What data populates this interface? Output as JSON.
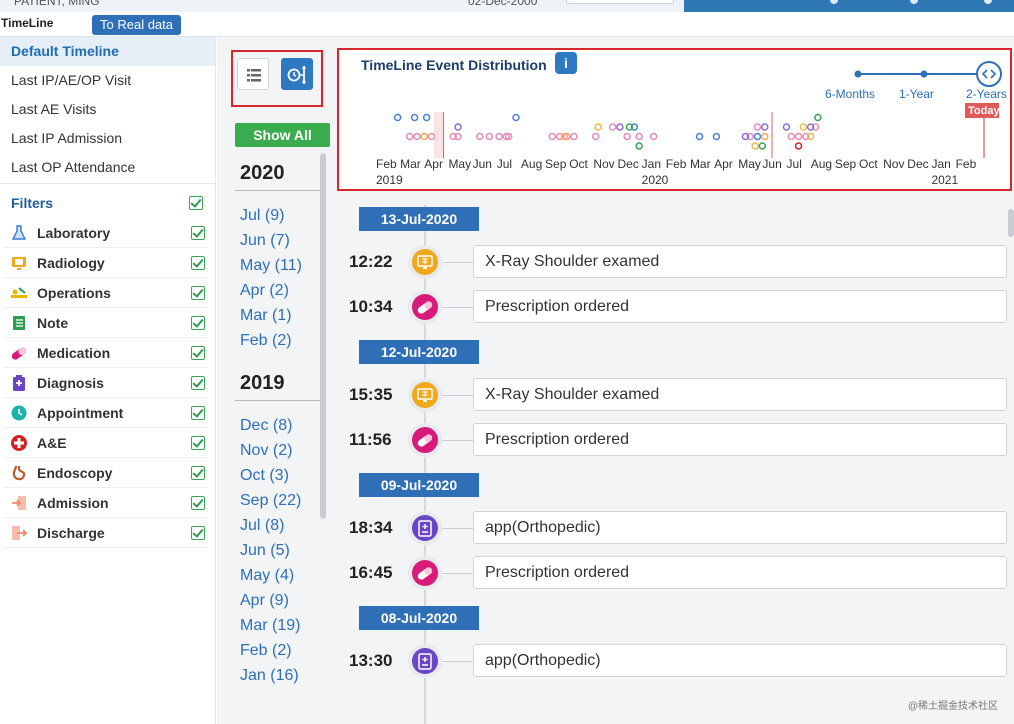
{
  "header": {
    "patient": "PATIENT, MING",
    "date": "02-Dec-2000",
    "app_title": "TimeLine",
    "real_data_button": "To Real data"
  },
  "sidebar": {
    "menu": [
      {
        "label": "Default Timeline",
        "active": true
      },
      {
        "label": "Last IP/AE/OP Visit",
        "active": false
      },
      {
        "label": "Last AE Visits",
        "active": false
      },
      {
        "label": "Last IP Admission",
        "active": false
      },
      {
        "label": "Last OP Attendance",
        "active": false
      }
    ],
    "filters_label": "Filters",
    "filters": [
      {
        "label": "Laboratory",
        "icon": "flask-icon",
        "color": "#3a7bd5",
        "checked": true
      },
      {
        "label": "Radiology",
        "icon": "xray-monitor-icon",
        "color": "#f0a81c",
        "checked": true
      },
      {
        "label": "Operations",
        "icon": "surgery-bed-icon",
        "color": "#e6b800",
        "checked": true
      },
      {
        "label": "Note",
        "icon": "notebook-icon",
        "color": "#2e9b4e",
        "checked": true
      },
      {
        "label": "Medication",
        "icon": "pill-capsule-icon",
        "color": "#d81b7a",
        "checked": true
      },
      {
        "label": "Diagnosis",
        "icon": "clipboard-plus-icon",
        "color": "#6a45c6",
        "checked": true
      },
      {
        "label": "Appointment",
        "icon": "clock-icon",
        "color": "#19b3a8",
        "checked": true
      },
      {
        "label": "A&E",
        "icon": "red-cross-icon",
        "color": "#d32020",
        "checked": true
      },
      {
        "label": "Endoscopy",
        "icon": "stomach-icon",
        "color": "#c0572b",
        "checked": true
      },
      {
        "label": "Admission",
        "icon": "enter-door-icon",
        "color": "#ef8a6a",
        "checked": true
      },
      {
        "label": "Discharge",
        "icon": "exit-door-icon",
        "color": "#ef8a6a",
        "checked": true
      }
    ]
  },
  "midcol": {
    "show_all": "Show All",
    "years": [
      {
        "year": "2020",
        "months": [
          "Jul (9)",
          "Jun (7)",
          "May (11)",
          "Apr (2)",
          "Mar (1)",
          "Feb (2)"
        ]
      },
      {
        "year": "2019",
        "months": [
          "Dec (8)",
          "Nov (2)",
          "Oct (3)",
          "Sep (22)",
          "Jul (8)",
          "Jun (5)",
          "May (4)",
          "Apr (9)",
          "Mar (19)",
          "Feb (2)",
          "Jan (16)"
        ]
      }
    ]
  },
  "distribution": {
    "title": "TimeLine Event Distribution",
    "ranges": [
      "6-Months",
      "1-Year",
      "2-Years"
    ],
    "selected_range": "2-Years",
    "today_label": "Today"
  },
  "chart_data": {
    "type": "scatter",
    "x_months": [
      "Feb",
      "Mar",
      "Apr",
      "May",
      "Jun",
      "Jul",
      "Aug",
      "Sep",
      "Oct",
      "Nov",
      "Dec",
      "Jan",
      "Feb",
      "Mar",
      "Apr",
      "May",
      "Jun",
      "Jul",
      "Aug",
      "Sep",
      "Oct",
      "Nov",
      "Dec",
      "Jan",
      "Feb"
    ],
    "x_years": [
      {
        "label": "2019",
        "month_index": 0
      },
      {
        "label": "2020",
        "month_index": 11
      },
      {
        "label": "2021",
        "month_index": 23
      }
    ],
    "series": [
      {
        "color": "#4a7fd6",
        "points": [
          [
            0.4,
            3
          ],
          [
            1.1,
            3
          ],
          [
            1.6,
            3
          ],
          [
            5.3,
            3
          ],
          [
            10.2,
            2
          ],
          [
            12.9,
            1
          ],
          [
            13.6,
            1
          ],
          [
            15.3,
            1
          ]
        ]
      },
      {
        "color": "#e68ab8",
        "points": [
          [
            0.9,
            1
          ],
          [
            1.2,
            1
          ],
          [
            1.5,
            1
          ],
          [
            1.8,
            1
          ],
          [
            2.7,
            1
          ],
          [
            2.9,
            1
          ],
          [
            3.8,
            1
          ],
          [
            4.2,
            1
          ],
          [
            4.6,
            1
          ],
          [
            4.9,
            1
          ],
          [
            5.0,
            1
          ],
          [
            6.8,
            1
          ],
          [
            7.1,
            1
          ],
          [
            7.4,
            1
          ],
          [
            7.7,
            1
          ],
          [
            8.6,
            1
          ],
          [
            9.3,
            2
          ],
          [
            9.9,
            1
          ],
          [
            10.4,
            1
          ],
          [
            11.0,
            1
          ],
          [
            15.0,
            1
          ],
          [
            15.3,
            2
          ],
          [
            15.6,
            1
          ],
          [
            16.7,
            1
          ],
          [
            17.0,
            1
          ],
          [
            17.3,
            1
          ],
          [
            17.7,
            2
          ]
        ]
      },
      {
        "color": "#f0b84a",
        "points": [
          [
            1.5,
            1
          ],
          [
            7.3,
            1
          ],
          [
            8.7,
            2
          ],
          [
            15.2,
            0
          ],
          [
            15.6,
            1
          ],
          [
            17.2,
            2
          ],
          [
            17.5,
            1
          ]
        ]
      },
      {
        "color": "#3aa35a",
        "points": [
          [
            10.0,
            2
          ],
          [
            10.4,
            0
          ],
          [
            15.5,
            0
          ],
          [
            17.8,
            3
          ]
        ]
      },
      {
        "color": "#8a6cd8",
        "points": [
          [
            2.9,
            2
          ],
          [
            9.6,
            2
          ],
          [
            14.8,
            1
          ],
          [
            15.6,
            2
          ],
          [
            16.5,
            2
          ],
          [
            17.5,
            2
          ]
        ]
      },
      {
        "color": "#d32020",
        "points": [
          [
            17.0,
            0
          ]
        ]
      }
    ]
  },
  "timeline": [
    {
      "date": "13-Jul-2020",
      "events": [
        {
          "time": "12:22",
          "label": "X-Ray Shoulder examed",
          "type": "radiology"
        },
        {
          "time": "10:34",
          "label": "Prescription ordered",
          "type": "medication"
        }
      ]
    },
    {
      "date": "12-Jul-2020",
      "events": [
        {
          "time": "15:35",
          "label": "X-Ray Shoulder examed",
          "type": "radiology"
        },
        {
          "time": "11:56",
          "label": "Prescription ordered",
          "type": "medication"
        }
      ]
    },
    {
      "date": "09-Jul-2020",
      "events": [
        {
          "time": "18:34",
          "label": "app(Orthopedic)",
          "type": "diagnosis"
        },
        {
          "time": "16:45",
          "label": "Prescription ordered",
          "type": "medication"
        }
      ]
    },
    {
      "date": "08-Jul-2020",
      "events": [
        {
          "time": "13:30",
          "label": "app(Orthopedic)",
          "type": "diagnosis"
        }
      ]
    }
  ],
  "event_type_colors": {
    "radiology": "#f0a81c",
    "medication": "#d81b7a",
    "diagnosis": "#6a45c6"
  },
  "watermark": "@稀土掘金技术社区"
}
